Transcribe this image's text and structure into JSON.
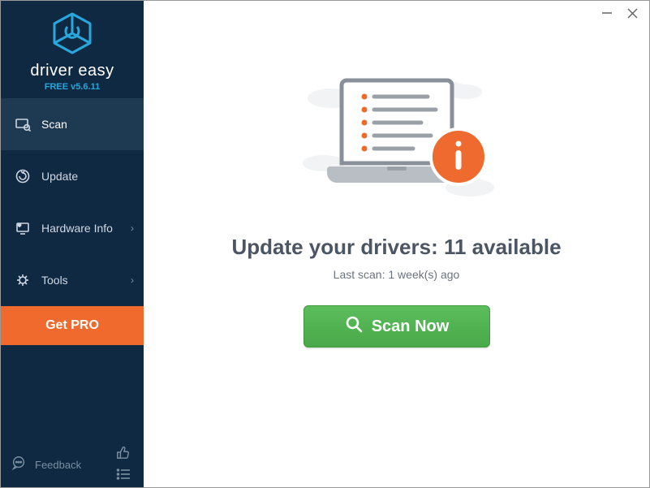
{
  "app": {
    "brand": "driver easy",
    "version_label": "FREE v5.6.11"
  },
  "sidebar": {
    "items": [
      {
        "label": "Scan"
      },
      {
        "label": "Update"
      },
      {
        "label": "Hardware Info"
      },
      {
        "label": "Tools"
      }
    ],
    "get_pro": "Get PRO",
    "feedback": "Feedback"
  },
  "main": {
    "headline": "Update your drivers: 11 available",
    "subline": "Last scan: 1 week(s) ago",
    "scan_button": "Scan Now"
  }
}
